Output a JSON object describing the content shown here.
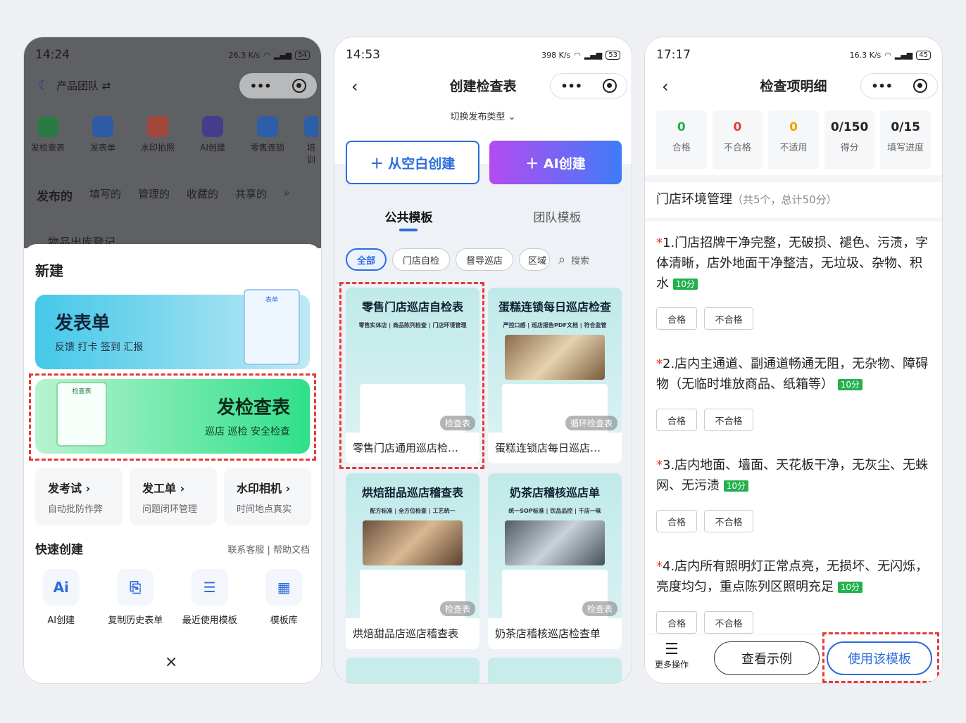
{
  "phone1": {
    "status": {
      "time": "14:24",
      "speed": "26.3 K/s",
      "battery": "54"
    },
    "team": "产品团队 ⇄",
    "apps": [
      "发检查表",
      "发表单",
      "水印拍照",
      "AI创建",
      "零售连锁",
      "培训"
    ],
    "tabs": [
      "发布的",
      "填写的",
      "管理的",
      "收藏的",
      "共享的"
    ],
    "peek_item": "物品出库登记",
    "sheet_title": "新建",
    "card_form": {
      "title": "发表单",
      "desc": "反馈 打卡 签到 汇报",
      "clip_label": "表单"
    },
    "card_check": {
      "title": "发检查表",
      "desc": "巡店 巡检 安全检查",
      "clip_label": "检查表"
    },
    "minis": [
      {
        "title": "发考试 ›",
        "desc": "自动批防作弊"
      },
      {
        "title": "发工单 ›",
        "desc": "问题闭环管理"
      },
      {
        "title": "水印相机 ›",
        "desc": "时间地点真实"
      }
    ],
    "quick_title": "快速创建",
    "quick_links": "联系客服 | 帮助文档",
    "quick": [
      {
        "label": "AI创建",
        "icon": "ai-icon",
        "glyph": "Ai"
      },
      {
        "label": "复制历史表单",
        "icon": "copy-icon",
        "glyph": "⎘"
      },
      {
        "label": "最近使用模板",
        "icon": "document-icon",
        "glyph": "☰"
      },
      {
        "label": "模板库",
        "icon": "grid-icon",
        "glyph": "▦"
      }
    ],
    "close": "×"
  },
  "phone2": {
    "status": {
      "time": "14:53",
      "speed": "398 K/s",
      "battery": "53"
    },
    "title": "创建检查表",
    "switch": "切换发布类型 ⌄",
    "btn_blank": "＋ 从空白创建",
    "btn_ai": "＋ AI创建",
    "tabs": [
      "公共模板",
      "团队模板"
    ],
    "chips": [
      "全部",
      "门店自检",
      "督导巡店",
      "区域"
    ],
    "search": "搜索",
    "templates": [
      {
        "title": "零售门店巡店自检表",
        "sub": "零售实体店 | 商品陈列检查 | 门店环境管理",
        "tag": "检查表",
        "name": "零售门店通用巡店检…"
      },
      {
        "title": "蛋糕连锁每日巡店检查",
        "sub": "严控口感 | 巡店报告PDF文档 | 符合监管",
        "tag": "循环检查表",
        "name": "蛋糕连锁店每日巡店…"
      },
      {
        "title": "烘焙甜品巡店稽查表",
        "sub": "配方标准 | 全方位检查 | 工艺统一",
        "tag": "检查表",
        "name": "烘焙甜品店巡店稽查表"
      },
      {
        "title": "奶茶店稽核巡店单",
        "sub": "统一SOP标准 | 饮品品控 | 千店一味",
        "tag": "检查表",
        "name": "奶茶店稽核巡店检查单"
      }
    ]
  },
  "phone3": {
    "status": {
      "time": "17:17",
      "speed": "16.3 K/s",
      "battery": "45"
    },
    "title": "检查项明细",
    "stats": [
      {
        "value": "0",
        "label": "合格",
        "color": "#22b14c"
      },
      {
        "value": "0",
        "label": "不合格",
        "color": "#e53935"
      },
      {
        "value": "0",
        "label": "不适用",
        "color": "#f0a500"
      },
      {
        "value": "0/150",
        "label": "得分",
        "color": "#222222"
      },
      {
        "value": "0/15",
        "label": "填写进度",
        "color": "#222222"
      }
    ],
    "section": "门店环境管理",
    "section_meta": "（共5个，总计50分）",
    "items": [
      {
        "text": "1.门店招牌干净完整，无破损、褪色、污渍，字体清晰，店外地面干净整洁，无垃圾、杂物、积水",
        "points": "10分"
      },
      {
        "text": "2.店内主通道、副通道畅通无阻，无杂物、障碍物（无临时堆放商品、纸箱等）",
        "points": "10分"
      },
      {
        "text": "3.店内地面、墙面、天花板干净，无灰尘、无蛛网、无污渍",
        "points": "10分"
      },
      {
        "text": "4.店内所有照明灯正常点亮，无损坏、无闪烁，亮度均匀，重点陈列区照明充足",
        "points": "10分"
      }
    ],
    "opt_pass": "合格",
    "opt_fail": "不合格",
    "more": "更多操作",
    "view_example": "查看示例",
    "use_template": "使用该模板"
  }
}
